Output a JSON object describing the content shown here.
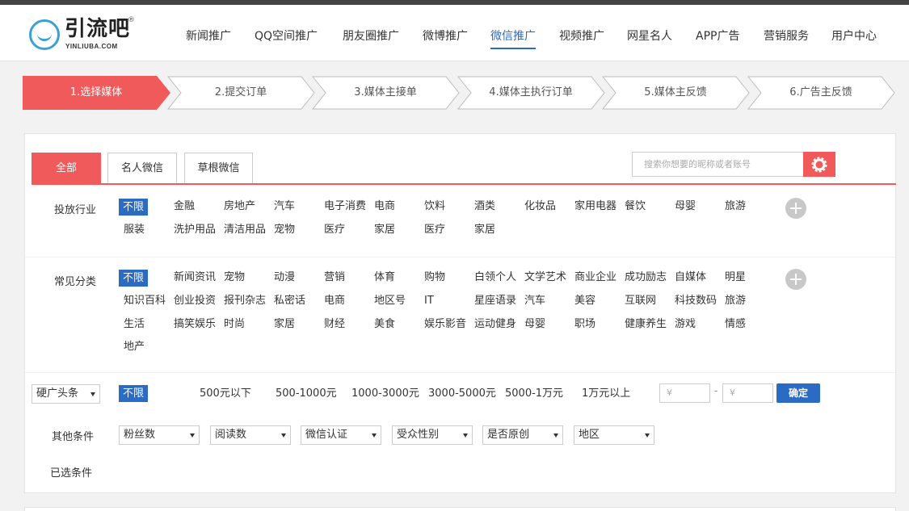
{
  "brand": {
    "name_cn": "引流吧",
    "name_en": "YINLIUBA.COM",
    "reg": "®"
  },
  "nav": [
    "新闻推广",
    "QQ空间推广",
    "朋友圈推广",
    "微博推广",
    "微信推广",
    "视频推广",
    "网星名人",
    "APP广告",
    "营销服务",
    "用户中心"
  ],
  "nav_active": "微信推广",
  "steps": [
    "1.选择媒体",
    "2.提交订单",
    "3.媒体主接单",
    "4.媒体主执行订单",
    "5.媒体主反馈",
    "6.广告主反馈"
  ],
  "tabs": [
    "全部",
    "名人微信",
    "草根微信"
  ],
  "search": {
    "placeholder": "搜索你想要的昵称或者账号"
  },
  "industry": {
    "label": "投放行业",
    "selected": "不限",
    "row1": [
      "金融",
      "房地产",
      "汽车",
      "电子消费",
      "电商",
      "饮料",
      "酒类",
      "化妆品",
      "家用电器",
      "餐饮",
      "母婴",
      "旅游"
    ],
    "row2": [
      "服装",
      "洗护用品",
      "清洁用品",
      "宠物",
      "医疗",
      "家居",
      "医疗",
      "家居"
    ]
  },
  "category": {
    "label": "常见分类",
    "selected": "不限",
    "row1": [
      "新闻资讯",
      "宠物",
      "动漫",
      "营销",
      "体育",
      "购物",
      "白领个人",
      "文学艺术",
      "商业企业",
      "成功励志",
      "自媒体",
      "明星"
    ],
    "row2": [
      "知识百科",
      "创业投资",
      "报刊杂志",
      "私密话",
      "电商",
      "地区号",
      "IT",
      "星座语录",
      "汽车",
      "美容",
      "互联网",
      "科技数码",
      "旅游"
    ],
    "row3": [
      "生活",
      "搞笑娱乐",
      "时尚",
      "家居",
      "财经",
      "美食",
      "娱乐影音",
      "运动健身",
      "母婴",
      "职场",
      "健康养生",
      "游戏",
      "情感"
    ],
    "row4": [
      "地产"
    ]
  },
  "price": {
    "type_select": "硬广头条",
    "selected": "不限",
    "options": [
      "500元以下",
      "500-1000元",
      "1000-3000元",
      "3000-5000元",
      "5000-1万元",
      "1万元以上"
    ],
    "min_placeholder": "¥",
    "max_placeholder": "¥",
    "dash": "-",
    "confirm": "确定"
  },
  "other": {
    "label": "其他条件",
    "selects": [
      "粉丝数",
      "阅读数",
      "微信认证",
      "受众性别",
      "是否原创",
      "地区"
    ]
  },
  "chosen_label": "已选条件",
  "colors": {
    "accent": "#f05a5a",
    "primary": "#2b6bc4"
  }
}
